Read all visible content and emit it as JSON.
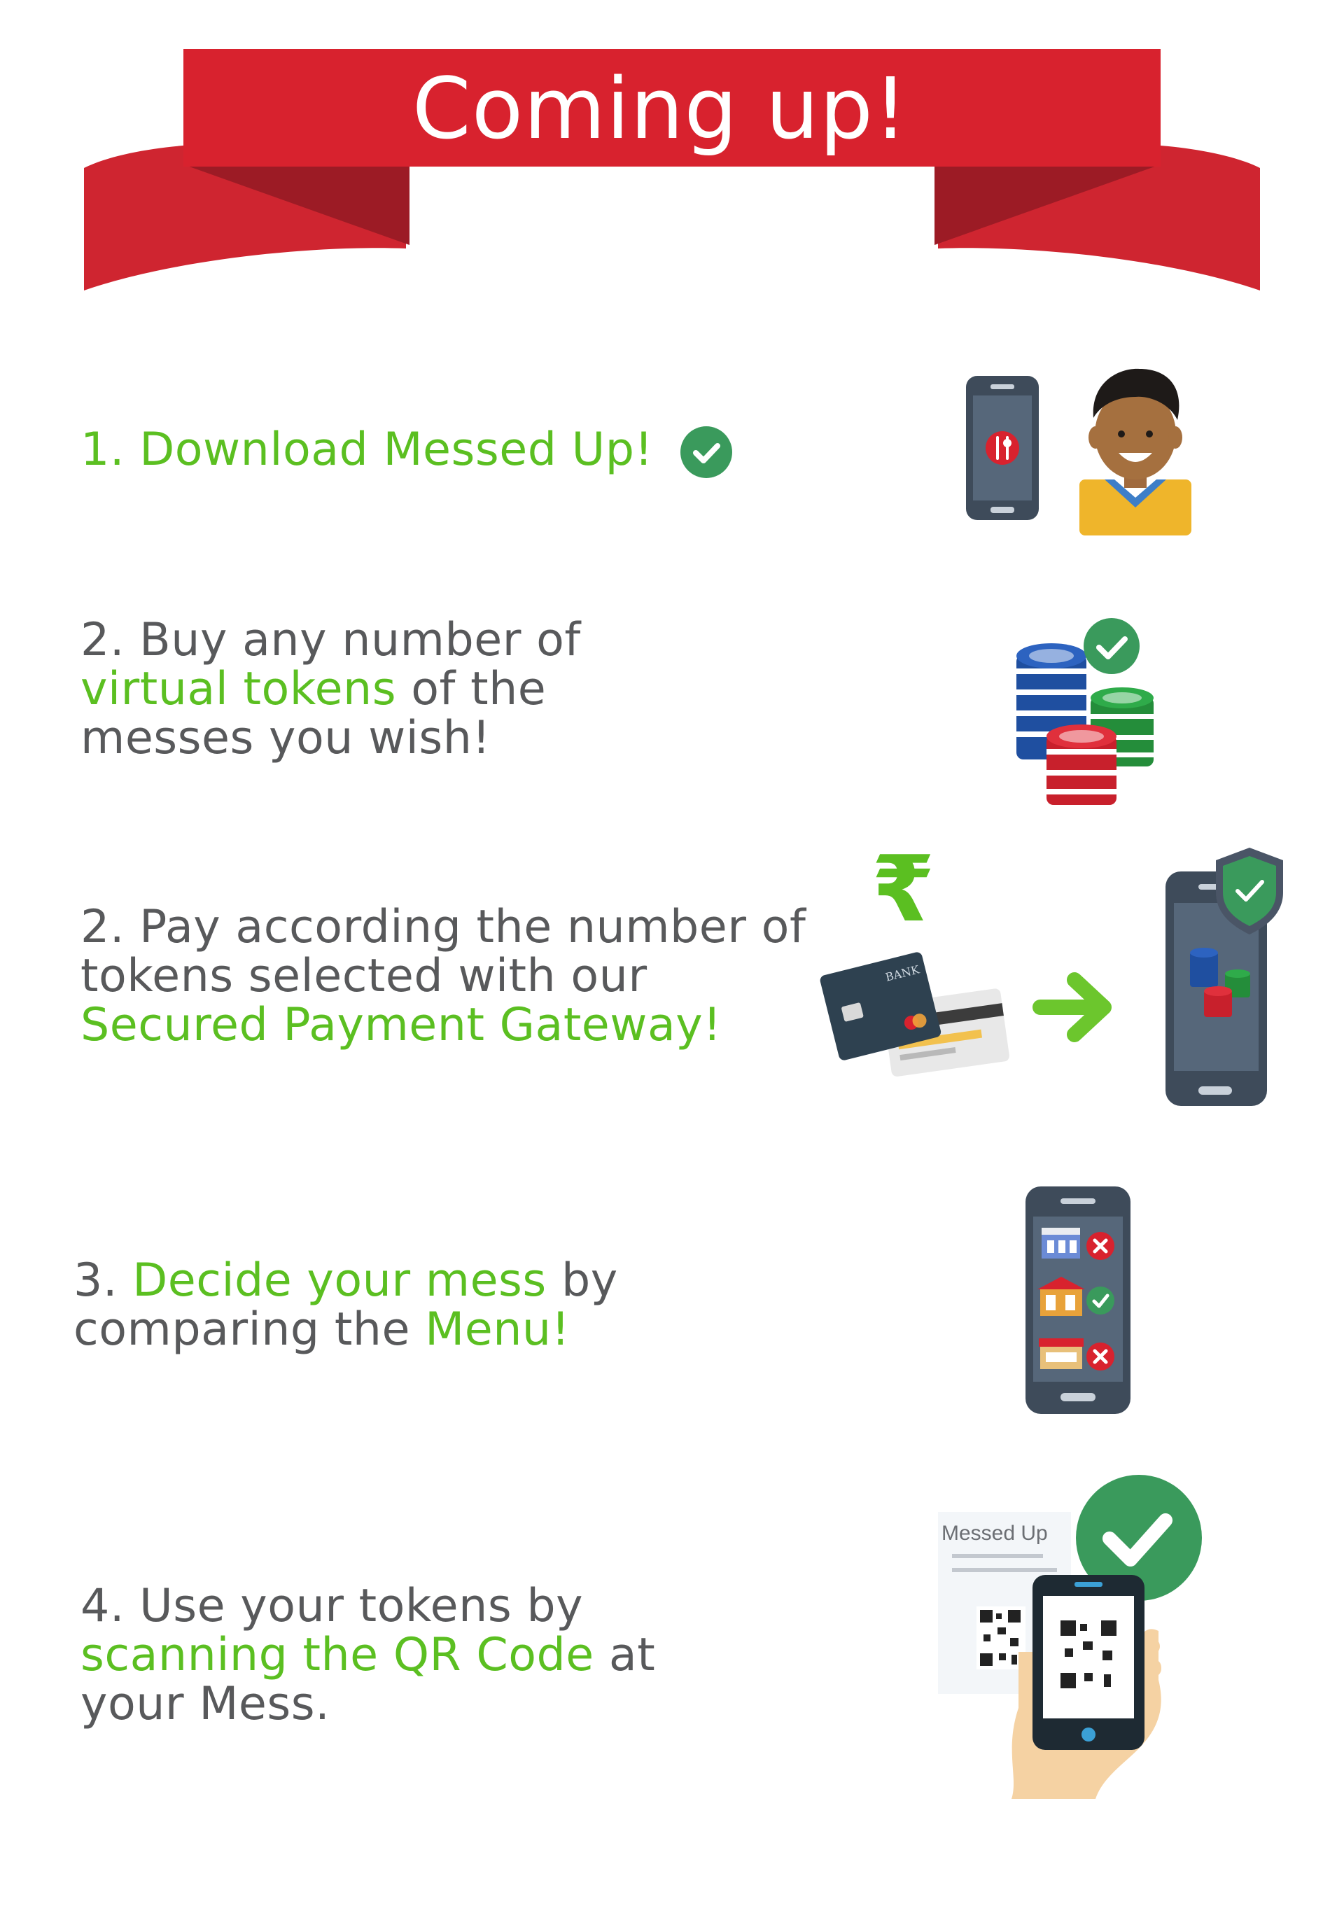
{
  "banner": {
    "title": "Coming up!"
  },
  "steps": [
    {
      "num": "1.",
      "text": "Download Messed Up!"
    },
    {
      "line1": "2. Buy any number of",
      "line2_highlight": "virtual tokens",
      "line2_rest": " of the",
      "line3": "messes you wish!"
    },
    {
      "line1": "2. Pay according the number of",
      "line2": "tokens selected with our",
      "line3_highlight": "Secured Payment Gateway!"
    },
    {
      "line1_num": "3. ",
      "line1_highlight": "Decide your mess",
      "line1_rest": " by",
      "line2_pre": "comparing the ",
      "line2_highlight": "Menu!"
    },
    {
      "line1": "4. Use your tokens by",
      "line2_highlight": "scanning the QR Code",
      "line2_rest": " at",
      "line3": "your Mess."
    }
  ],
  "illustrations": {
    "card_text": "BANK",
    "rupee": "₹",
    "receipt_title": "Messed Up"
  },
  "colors": {
    "banner_red": "#d6232f",
    "banner_dark": "#b01e2a",
    "accent_green": "#5bbf21",
    "check_green": "#3a9a5c",
    "text_gray": "#58595b"
  }
}
